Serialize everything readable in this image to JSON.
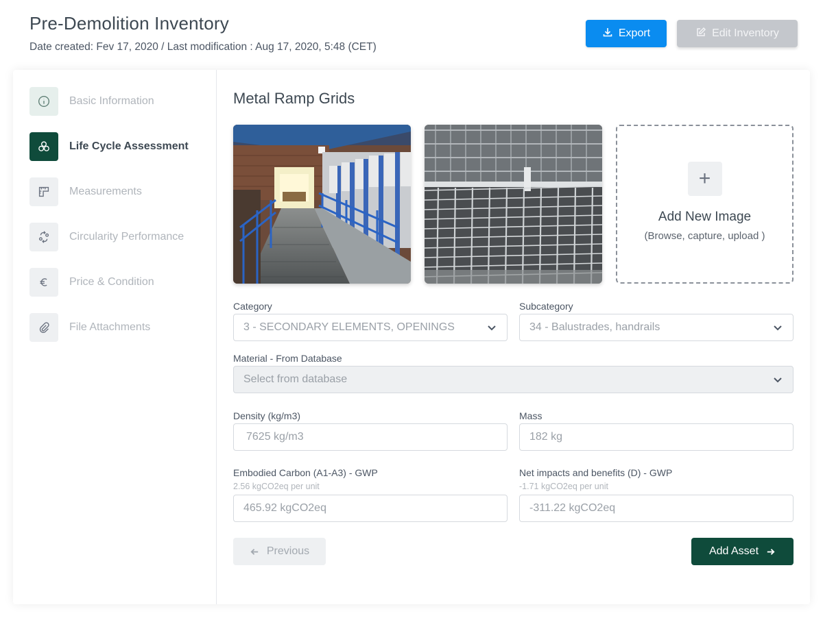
{
  "header": {
    "title": "Pre-Demolition Inventory",
    "meta": "Date created: Fev 17, 2020 / Last modification : Aug 17, 2020, 5:48 (CET)",
    "export_label": "Export",
    "edit_label": "Edit Inventory"
  },
  "sidebar": {
    "items": [
      {
        "label": "Basic Information",
        "icon": "info-icon",
        "state": "done"
      },
      {
        "label": "Life Cycle Assessment",
        "icon": "circles-icon",
        "state": "active"
      },
      {
        "label": "Measurements",
        "icon": "ruler-icon",
        "state": "pending"
      },
      {
        "label": "Circularity Performance",
        "icon": "cycle-icon",
        "state": "pending"
      },
      {
        "label": "Price & Condition",
        "icon": "euro-icon",
        "state": "pending"
      },
      {
        "label": "File Attachments",
        "icon": "paperclip-icon",
        "state": "pending"
      }
    ]
  },
  "main": {
    "title": "Metal Ramp Grids",
    "add_image": {
      "title": "Add New Image",
      "subtitle": "(Browse, capture, upload )"
    },
    "category": {
      "label": "Category",
      "value": "3 - SECONDARY ELEMENTS, OPENINGS"
    },
    "subcategory": {
      "label": "Subcategory",
      "value": "34 - Balustrades, handrails"
    },
    "material": {
      "label": "Material - From Database",
      "placeholder": "Select from database"
    },
    "density": {
      "label": "Density (kg/m3)",
      "value": "7625 kg/m3"
    },
    "mass": {
      "label": "Mass",
      "value": "182 kg"
    },
    "embodied": {
      "label": "Embodied Carbon (A1-A3) - GWP",
      "hint": "2.56 kgCO2eq per unit",
      "value": "465.92 kgCO2eq"
    },
    "net_impacts": {
      "label": "Net impacts and benefits (D) - GWP",
      "hint": "-1.71 kgCO2eq per unit",
      "value": "-311.22 kgCO2eq"
    },
    "previous_label": "Previous",
    "add_asset_label": "Add Asset"
  },
  "colors": {
    "primary_blue": "#0a8cf0",
    "dark_green": "#0f4b3b",
    "disabled_gray": "#c4c7cc"
  }
}
